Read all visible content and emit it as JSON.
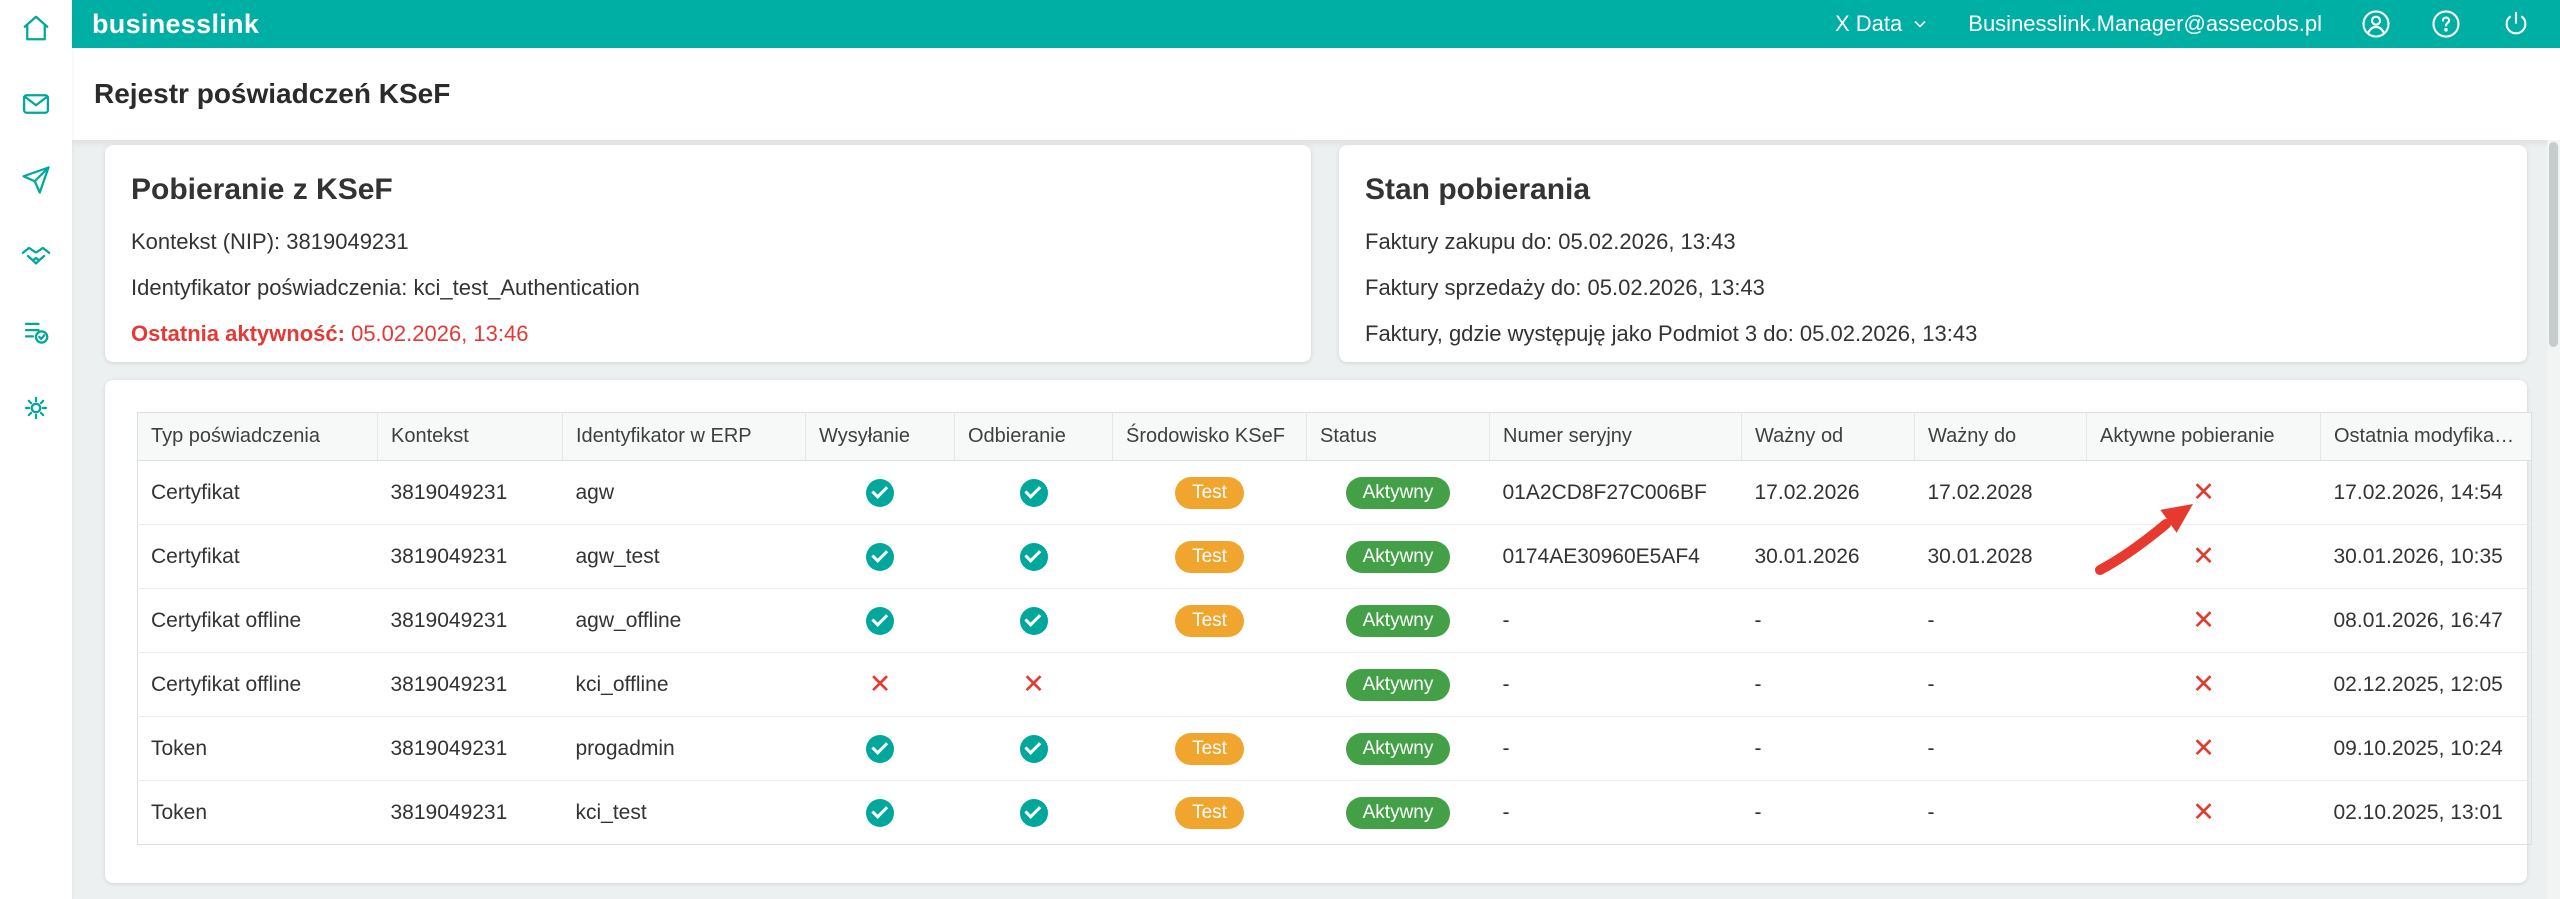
{
  "header": {
    "brand": "businesslink",
    "tenant": "X Data",
    "user_email": "Businesslink.Manager@assecobs.pl"
  },
  "page": {
    "title": "Rejestr poświadczeń KSeF"
  },
  "cards": {
    "pobieranie": {
      "title": "Pobieranie z KSeF",
      "kontekst_label": "Kontekst (NIP):",
      "kontekst_value": "3819049231",
      "identyfikator_label": "Identyfikator poświadczenia:",
      "identyfikator_value": "kci_test_Authentication",
      "aktywnosc_label": "Ostatnia aktywność:",
      "aktywnosc_value": "05.02.2026, 13:46"
    },
    "stan": {
      "title": "Stan pobierania",
      "lines": [
        "Faktury zakupu do: 05.02.2026, 13:43",
        "Faktury sprzedaży do: 05.02.2026, 13:43",
        "Faktury, gdzie występuję jako Podmiot 3 do: 05.02.2026, 13:43"
      ]
    }
  },
  "table": {
    "columns": [
      "Typ poświadczenia",
      "Kontekst",
      "Identyfikator w ERP",
      "Wysyłanie",
      "Odbieranie",
      "Środowisko KSeF",
      "Status",
      "Numer seryjny",
      "Ważny od",
      "Ważny do",
      "Aktywne pobieranie",
      "Ostatnia modyfikacja"
    ],
    "rows": [
      {
        "typ": "Certyfikat",
        "kontekst": "3819049231",
        "id_erp": "agw",
        "wysylanie": "check",
        "odbieranie": "check",
        "srodowisko": "Test",
        "status": "Aktywny",
        "numer": "01A2CD8F27C006BF",
        "wazny_od": "17.02.2026",
        "wazny_do": "17.02.2028",
        "aktywne": "cross",
        "modyfikacja": "17.02.2026, 14:54"
      },
      {
        "typ": "Certyfikat",
        "kontekst": "3819049231",
        "id_erp": "agw_test",
        "wysylanie": "check",
        "odbieranie": "check",
        "srodowisko": "Test",
        "status": "Aktywny",
        "numer": "0174AE30960E5AF4",
        "wazny_od": "30.01.2026",
        "wazny_do": "30.01.2028",
        "aktywne": "cross",
        "modyfikacja": "30.01.2026, 10:35"
      },
      {
        "typ": "Certyfikat offline",
        "kontekst": "3819049231",
        "id_erp": "agw_offline",
        "wysylanie": "check",
        "odbieranie": "check",
        "srodowisko": "Test",
        "status": "Aktywny",
        "numer": "-",
        "wazny_od": "-",
        "wazny_do": "-",
        "aktywne": "cross",
        "modyfikacja": "08.01.2026, 16:47"
      },
      {
        "typ": "Certyfikat offline",
        "kontekst": "3819049231",
        "id_erp": "kci_offline",
        "wysylanie": "cross",
        "odbieranie": "cross",
        "srodowisko": "",
        "status": "Aktywny",
        "numer": "-",
        "wazny_od": "-",
        "wazny_do": "-",
        "aktywne": "cross",
        "modyfikacja": "02.12.2025, 12:05"
      },
      {
        "typ": "Token",
        "kontekst": "3819049231",
        "id_erp": "progadmin",
        "wysylanie": "check",
        "odbieranie": "check",
        "srodowisko": "Test",
        "status": "Aktywny",
        "numer": "-",
        "wazny_od": "-",
        "wazny_do": "-",
        "aktywne": "cross",
        "modyfikacja": "09.10.2025, 10:24"
      },
      {
        "typ": "Token",
        "kontekst": "3819049231",
        "id_erp": "kci_test",
        "wysylanie": "check",
        "odbieranie": "check",
        "srodowisko": "Test",
        "status": "Aktywny",
        "numer": "-",
        "wazny_od": "-",
        "wazny_do": "-",
        "aktywne": "cross",
        "modyfikacja": "02.10.2025, 13:01"
      }
    ]
  },
  "icons": {
    "sidebar": [
      "home-icon",
      "inbox-icon",
      "send-icon",
      "handshake-icon",
      "tasks-icon",
      "settings-icon"
    ],
    "topbar": [
      "chevron-down-icon",
      "user-icon",
      "help-icon",
      "power-icon"
    ],
    "marks": {
      "check": "teal-circle-check",
      "cross": "red-x"
    }
  },
  "colors": {
    "teal": "#00AFA4",
    "badge_test": "#F0A52F",
    "badge_active": "#43A047",
    "alert_red": "#E53935",
    "background": "#edf0f0"
  }
}
